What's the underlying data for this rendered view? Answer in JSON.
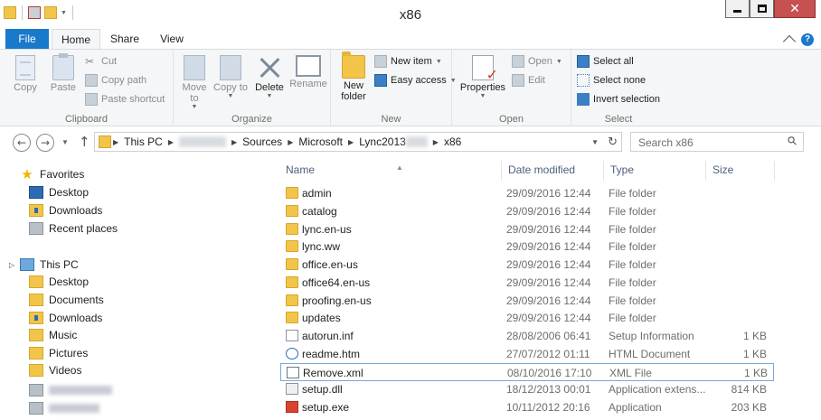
{
  "window": {
    "title": "x86"
  },
  "tabs": {
    "file": "File",
    "home": "Home",
    "share": "Share",
    "view": "View"
  },
  "ribbon": {
    "clipboard": {
      "copy": "Copy",
      "paste": "Paste",
      "cut": "Cut",
      "copy_path": "Copy path",
      "paste_shortcut": "Paste shortcut",
      "label": "Clipboard"
    },
    "organize": {
      "move_to": "Move to",
      "copy_to": "Copy to",
      "delete": "Delete",
      "rename": "Rename",
      "label": "Organize"
    },
    "new": {
      "new_folder": "New folder",
      "new_item": "New item",
      "easy_access": "Easy access",
      "label": "New"
    },
    "open": {
      "properties": "Properties",
      "open": "Open",
      "edit": "Edit",
      "label": "Open"
    },
    "select": {
      "select_all": "Select all",
      "select_none": "Select none",
      "invert_selection": "Invert selection",
      "label": "Select"
    }
  },
  "address": {
    "crumbs": [
      "This PC",
      "Sources",
      "Microsoft",
      "Lync2013",
      "x86"
    ],
    "search_placeholder": "Search x86"
  },
  "nav": {
    "favorites": "Favorites",
    "fav_items": [
      "Desktop",
      "Downloads",
      "Recent places"
    ],
    "this_pc": "This PC",
    "pc_items": [
      "Desktop",
      "Documents",
      "Downloads",
      "Music",
      "Pictures",
      "Videos"
    ]
  },
  "columns": {
    "name": "Name",
    "date": "Date modified",
    "type": "Type",
    "size": "Size"
  },
  "files": [
    {
      "name": "admin",
      "date": "29/09/2016 12:44",
      "type": "File folder",
      "size": "",
      "icon": "folder-icon"
    },
    {
      "name": "catalog",
      "date": "29/09/2016 12:44",
      "type": "File folder",
      "size": "",
      "icon": "folder-icon"
    },
    {
      "name": "lync.en-us",
      "date": "29/09/2016 12:44",
      "type": "File folder",
      "size": "",
      "icon": "folder-icon"
    },
    {
      "name": "lync.ww",
      "date": "29/09/2016 12:44",
      "type": "File folder",
      "size": "",
      "icon": "folder-icon"
    },
    {
      "name": "office.en-us",
      "date": "29/09/2016 12:44",
      "type": "File folder",
      "size": "",
      "icon": "folder-icon"
    },
    {
      "name": "office64.en-us",
      "date": "29/09/2016 12:44",
      "type": "File folder",
      "size": "",
      "icon": "folder-icon"
    },
    {
      "name": "proofing.en-us",
      "date": "29/09/2016 12:44",
      "type": "File folder",
      "size": "",
      "icon": "folder-icon"
    },
    {
      "name": "updates",
      "date": "29/09/2016 12:44",
      "type": "File folder",
      "size": "",
      "icon": "folder-icon"
    },
    {
      "name": "autorun.inf",
      "date": "28/08/2006 06:41",
      "type": "Setup Information",
      "size": "1 KB",
      "icon": "inf-file-icon"
    },
    {
      "name": "readme.htm",
      "date": "27/07/2012 01:11",
      "type": "HTML Document",
      "size": "1 KB",
      "icon": "html-file-icon"
    },
    {
      "name": "Remove.xml",
      "date": "08/10/2016 17:10",
      "type": "XML File",
      "size": "1 KB",
      "icon": "xml-file-icon",
      "selected": true
    },
    {
      "name": "setup.dll",
      "date": "18/12/2013 00:01",
      "type": "Application extens...",
      "size": "814 KB",
      "icon": "dll-file-icon"
    },
    {
      "name": "setup.exe",
      "date": "10/11/2012 20:16",
      "type": "Application",
      "size": "203 KB",
      "icon": "exe-file-icon"
    }
  ]
}
